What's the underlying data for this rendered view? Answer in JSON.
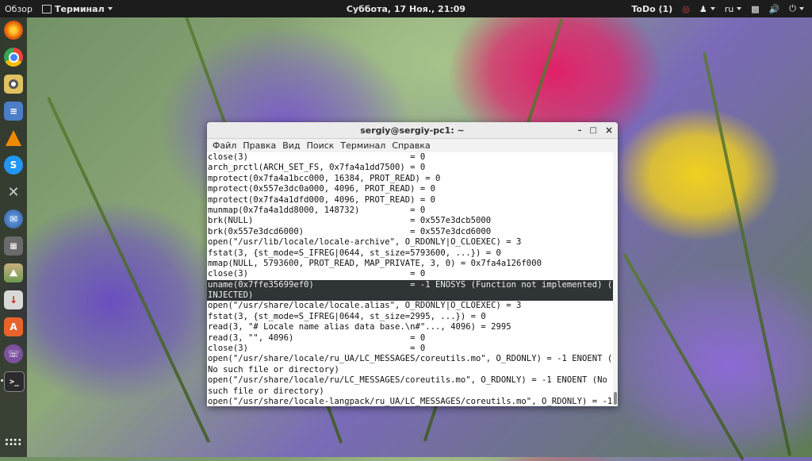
{
  "topbar": {
    "overview": "Обзор",
    "app_menu": "Терминал",
    "clock": "Суббота, 17 Ноя., 21:09",
    "todo": "ToDo (1)",
    "language": "ru",
    "icons": [
      "todo-indicator-icon",
      "accessibility-icon",
      "language-icon",
      "network-icon",
      "volume-icon",
      "power-icon"
    ]
  },
  "dock": {
    "items": [
      {
        "name": "firefox",
        "icon": "firefox-icon",
        "color": "#e66000"
      },
      {
        "name": "chrome",
        "icon": "chrome-icon",
        "color": "#4285f4"
      },
      {
        "name": "rhythmbox",
        "icon": "music-icon",
        "color": "#d9b84a"
      },
      {
        "name": "text-editor",
        "icon": "document-icon",
        "color": "#4a7ec9"
      },
      {
        "name": "vlc",
        "icon": "vlc-icon",
        "color": "#f08a00"
      },
      {
        "name": "skype",
        "icon": "skype-icon",
        "color": "#2196f3"
      },
      {
        "name": "settings",
        "icon": "tools-icon",
        "color": "#9aa4b0"
      },
      {
        "name": "thunderbird",
        "icon": "mail-icon",
        "color": "#3a6fb5"
      },
      {
        "name": "calculator",
        "icon": "calculator-icon",
        "color": "#7a7a7a"
      },
      {
        "name": "image-viewer",
        "icon": "image-icon",
        "color": "#8a7a5a"
      },
      {
        "name": "downloads",
        "icon": "download-icon",
        "color": "#c0c0c0"
      },
      {
        "name": "software",
        "icon": "software-center-icon",
        "color": "#e8632b"
      },
      {
        "name": "viber",
        "icon": "viber-icon",
        "color": "#7b519d"
      },
      {
        "name": "terminal",
        "icon": "terminal-icon",
        "color": "#2b2b2b"
      }
    ],
    "apps_grid": "apps-grid-icon"
  },
  "window": {
    "title": "sergiy@sergiy-pc1: ~",
    "minimize": "–",
    "maximize": "□",
    "close": "×",
    "menu": [
      "Файл",
      "Правка",
      "Вид",
      "Поиск",
      "Терминал",
      "Справка"
    ]
  },
  "terminal": {
    "lines": [
      "close(3)                                = 0",
      "arch_prctl(ARCH_SET_FS, 0x7fa4a1dd7500) = 0",
      "mprotect(0x7fa4a1bcc000, 16384, PROT_READ) = 0",
      "mprotect(0x557e3dc0a000, 4096, PROT_READ) = 0",
      "mprotect(0x7fa4a1dfd000, 4096, PROT_READ) = 0",
      "munmap(0x7fa4a1dd8000, 148732)          = 0",
      "brk(NULL)                               = 0x557e3dcb5000",
      "brk(0x557e3dcd6000)                     = 0x557e3dcd6000",
      "open(\"/usr/lib/locale/locale-archive\", O_RDONLY|O_CLOEXEC) = 3",
      "fstat(3, {st_mode=S_IFREG|0644, st_size=5793600, ...}) = 0",
      "mmap(NULL, 5793600, PROT_READ, MAP_PRIVATE, 3, 0) = 0x7fa4a126f000",
      "close(3)                                = 0",
      "uname(0x7ffe35699ef0)                   = -1 ENOSYS (Function not implemented) (",
      "INJECTED)",
      "open(\"/usr/share/locale/locale.alias\", O_RDONLY|O_CLOEXEC) = 3",
      "fstat(3, {st_mode=S_IFREG|0644, st_size=2995, ...}) = 0",
      "read(3, \"# Locale name alias data base.\\n#\"..., 4096) = 2995",
      "read(3, \"\", 4096)                       = 0",
      "close(3)                                = 0",
      "open(\"/usr/share/locale/ru_UA/LC_MESSAGES/coreutils.mo\", O_RDONLY) = -1 ENOENT (",
      "No such file or directory)",
      "open(\"/usr/share/locale/ru/LC_MESSAGES/coreutils.mo\", O_RDONLY) = -1 ENOENT (No",
      "such file or directory)",
      "open(\"/usr/share/locale-langpack/ru_UA/LC_MESSAGES/coreutils.mo\", O_RDONLY) = -1"
    ],
    "highlighted": [
      12,
      13
    ]
  }
}
